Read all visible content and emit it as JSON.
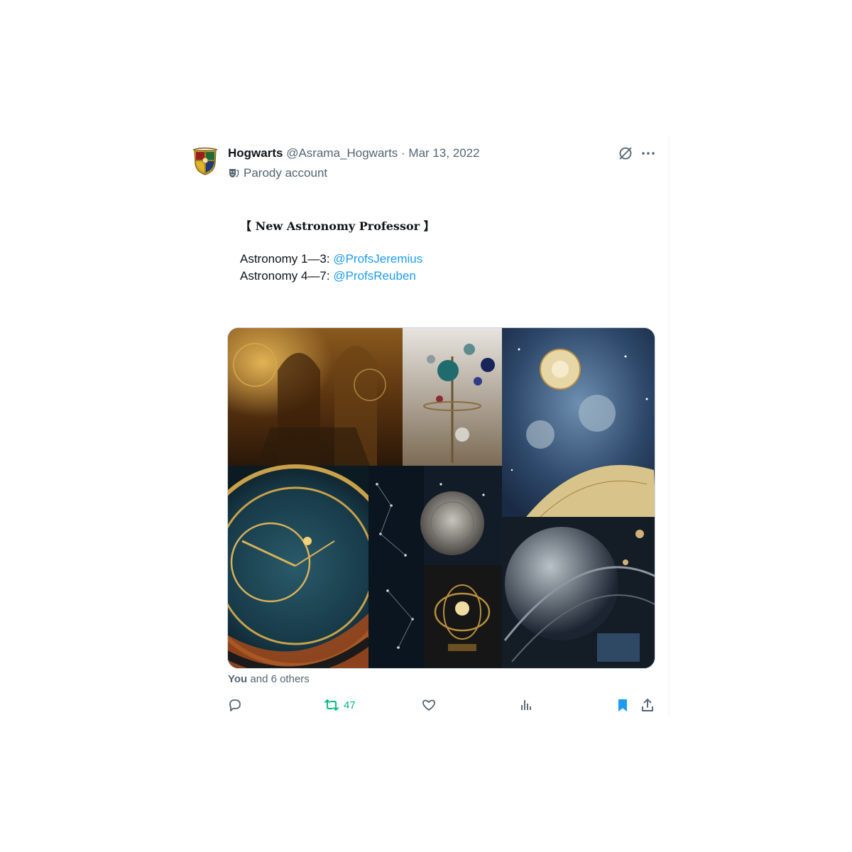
{
  "post": {
    "display_name": "Hogwarts",
    "handle": "@Asrama_Hogwarts",
    "separator": " · ",
    "date": "Mar 13, 2022",
    "parody_label": "Parody account",
    "title": "【 New Astronomy Professor 】",
    "lines": [
      {
        "prefix": "Astronomy 1—3: ",
        "mention": "@ProfsJeremius"
      },
      {
        "prefix": "Astronomy 4—7: ",
        "mention": "@ProfsReuben"
      }
    ],
    "media_alt": "Astronomy collage",
    "likes": {
      "you": "You",
      "rest": " and 6 others"
    },
    "actions": {
      "reply_icon": "reply-icon",
      "repost_icon": "repost-icon",
      "repost_count": "47",
      "like_icon": "heart-icon",
      "views_icon": "views-icon",
      "bookmark_icon": "bookmark-icon",
      "share_icon": "share-icon"
    },
    "header_icons": [
      "grok-icon",
      "more-icon"
    ]
  },
  "colors": {
    "text": "#0f1419",
    "secondary": "#536471",
    "link": "#1d9bf0",
    "repost_active": "#00ba7c",
    "bookmark_active": "#1d9bf0"
  }
}
